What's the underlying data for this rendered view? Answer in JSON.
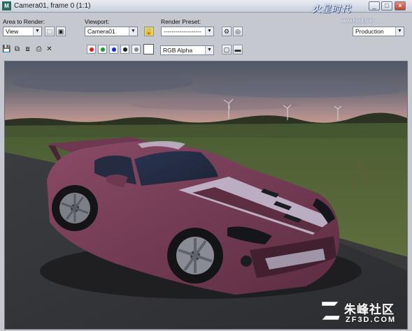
{
  "window": {
    "title": "Camera01, frame 0 (1:1)",
    "app_icon": "3ds-max-icon",
    "logo_text": "火星时代",
    "logo_sub": "www.hxsd.com"
  },
  "toolbar": {
    "area_label": "Area to Render:",
    "area_value": "View",
    "viewport_label": "Viewport:",
    "viewport_value": "Camera01",
    "preset_label": "Render Preset:",
    "preset_value": "-------------------",
    "production_value": "Production",
    "channel_value": "RGB Alpha"
  },
  "channels": {
    "red": "#e02020",
    "green": "#1f9a2a",
    "blue": "#1a2ad0",
    "mono": "#202020",
    "alpha": "#8a8a8a"
  },
  "watermark": {
    "text": "朱峰社区",
    "sub": "ZF3D.COM"
  }
}
